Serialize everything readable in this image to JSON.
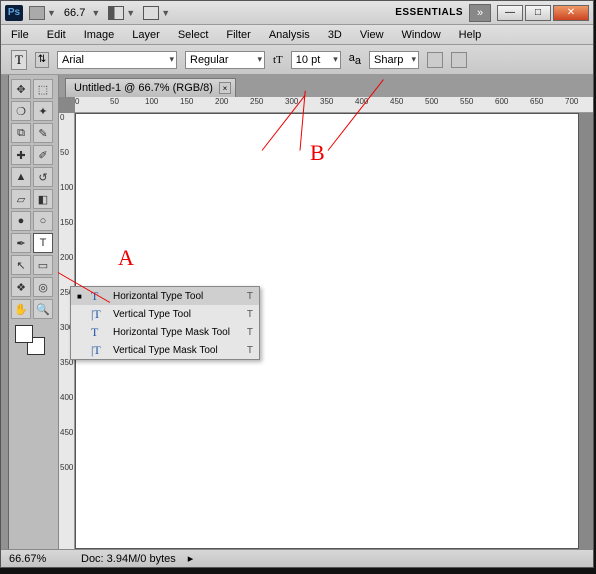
{
  "titlebar": {
    "zoom": "66.7",
    "workspace": "ESSENTIALS"
  },
  "menus": [
    "File",
    "Edit",
    "Image",
    "Layer",
    "Select",
    "Filter",
    "Analysis",
    "3D",
    "View",
    "Window",
    "Help"
  ],
  "options": {
    "font": "Arial",
    "style": "Regular",
    "size": "10 pt",
    "aa": "Sharp"
  },
  "tab": {
    "title": "Untitled-1 @ 66.7% (RGB/8)"
  },
  "ruler_h": [
    "0",
    "50",
    "100",
    "150",
    "200",
    "250",
    "300",
    "350",
    "400",
    "450",
    "500",
    "550",
    "600",
    "650",
    "700"
  ],
  "ruler_v": [
    "0",
    "50",
    "100",
    "150",
    "200",
    "250",
    "300",
    "350",
    "400",
    "450",
    "500"
  ],
  "flyout": [
    {
      "label": "Horizontal Type Tool",
      "key": "T",
      "icon": "T",
      "sel": true
    },
    {
      "label": "Vertical Type Tool",
      "key": "T",
      "icon": "|T"
    },
    {
      "label": "Horizontal Type Mask Tool",
      "key": "T",
      "icon": "T"
    },
    {
      "label": "Vertical Type Mask Tool",
      "key": "T",
      "icon": "|T"
    }
  ],
  "status": {
    "zoom": "66.67%",
    "doc": "Doc: 3.94M/0 bytes"
  },
  "annotations": {
    "a": "A",
    "b": "B"
  }
}
